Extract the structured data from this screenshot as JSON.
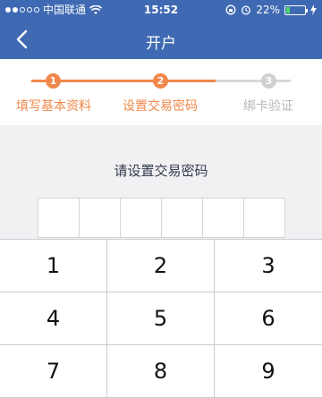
{
  "status_bar": {
    "carrier": "中国联通",
    "time": "15:52",
    "battery_percent": "22%",
    "battery_level": 0.22
  },
  "nav": {
    "title": "开户",
    "back_icon": "chevron-left-icon"
  },
  "steps": [
    {
      "number": "1",
      "label": "填写基本资料",
      "state": "done"
    },
    {
      "number": "2",
      "label": "设置交易密码",
      "state": "done"
    },
    {
      "number": "3",
      "label": "绑卡验证",
      "state": "todo"
    }
  ],
  "colors": {
    "nav_bg": "#3f69b3",
    "accent": "#f0884a",
    "inactive": "#d0d0d0"
  },
  "prompt": "请设置交易密码",
  "password_length": 6,
  "keypad": [
    "1",
    "2",
    "3",
    "4",
    "5",
    "6",
    "7",
    "8",
    "9"
  ]
}
